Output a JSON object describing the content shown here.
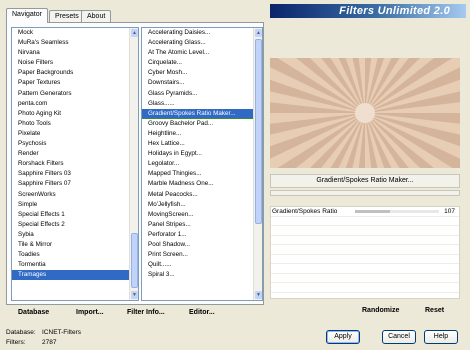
{
  "tabs": [
    "Navigator",
    "Presets",
    "About"
  ],
  "app_title": "Filters Unlimited 2.0",
  "categories": {
    "items": [
      "Mock",
      "MuRa's Seamless",
      "Nirvana",
      "Noise Filters",
      "Paper Backgrounds",
      "Paper Textures",
      "Pattern Generators",
      "penta.com",
      "Photo Aging Kit",
      "Photo Tools",
      "Pixelate",
      "Psychosis",
      "Render",
      "Rorshack Filters",
      "Sapphire Filters 03",
      "Sapphire Filters 07",
      "ScreenWorks",
      "Simple",
      "Special Effects 1",
      "Special Effects 2",
      "Sybia",
      "Tile & Mirror",
      "Toadies",
      "Tormentia",
      "Tramages"
    ],
    "selected": "Tramages"
  },
  "filters": {
    "items": [
      "Accelerating Daisies...",
      "Accelerating Glass...",
      "At The Atomic Level...",
      "Cirquelate...",
      "Cyber Mosh...",
      "Downstairs...",
      "Glass Pyramids...",
      "Glass......",
      "Gradient/Spokes Ratio Maker...",
      "Groovy Bachelor Pad...",
      "Heightline...",
      "Hex Lattice...",
      "Holidays in Egypt...",
      "Legolator...",
      "Mapped Thingies...",
      "Marble Madness One...",
      "Metal Peacocks...",
      "Mo'Jellyfish...",
      "MovingScreen...",
      "Panel Stripes...",
      "Perforator 1...",
      "Pool Shadow...",
      "Print Screen...",
      "Quilt......",
      "Spiral 3..."
    ],
    "highlighted": "Gradient/Spokes Ratio Maker..."
  },
  "buttons": {
    "database": "Database",
    "import": "Import...",
    "filter_info": "Filter Info...",
    "editor": "Editor...",
    "randomize": "Randomize",
    "reset": "Reset",
    "apply": "Apply",
    "cancel": "Cancel",
    "help": "Help"
  },
  "filter_name": "Gradient/Spokes Ratio Maker...",
  "parameter": {
    "label": "Gradient/Spokes Ratio",
    "value": "107",
    "fraction": 0.42
  },
  "status": {
    "database_label": "Database:",
    "database_value": "ICNET-Filters",
    "filters_label": "Filters:",
    "filters_value": "2787"
  },
  "colors": {
    "preview_base": "#e8cdb5",
    "preview_spoke": "#b08a6e",
    "selection": "#316ac5",
    "title_dark": "#0a246a"
  }
}
